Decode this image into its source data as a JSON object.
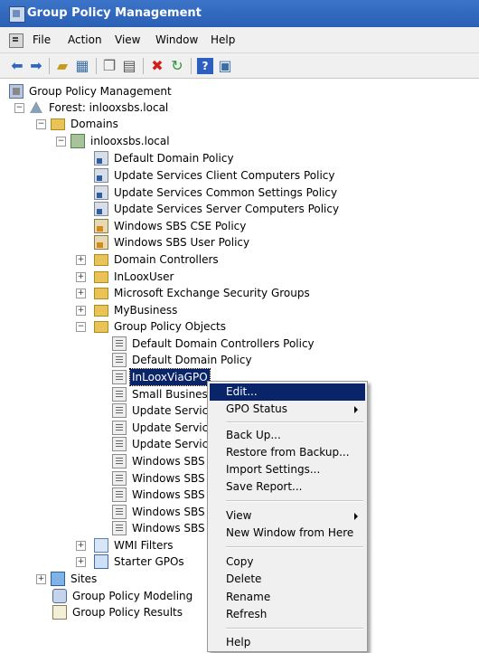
{
  "window": {
    "title": "Group Policy Management"
  },
  "menu": [
    "File",
    "Action",
    "View",
    "Window",
    "Help"
  ],
  "toolbar": {
    "icons": [
      "back-arrow-icon",
      "forward-arrow-icon",
      "up-folder-icon",
      "show-hide-tree-icon",
      "copy-icon",
      "paste-icon",
      "delete-icon",
      "refresh-icon",
      "help-icon",
      "properties-icon"
    ]
  },
  "tree": {
    "root": "Group Policy Management",
    "forest": "Forest: inlooxsbs.local",
    "domains": "Domains",
    "domain": "inlooxsbs.local",
    "linked": [
      "Default Domain Policy",
      "Update Services Client Computers Policy",
      "Update Services Common Settings Policy",
      "Update Services Server Computers Policy",
      "Windows SBS CSE Policy",
      "Windows SBS User Policy"
    ],
    "ous": [
      "Domain Controllers",
      "InLooxUser",
      "Microsoft Exchange Security Groups",
      "MyBusiness"
    ],
    "gpo_folder": "Group Policy Objects",
    "gpos": [
      "Default Domain Controllers Policy",
      "Default Domain Policy",
      "InLooxViaGPO",
      "Small Business",
      "Update Servic",
      "Update Servic",
      "Update Servic",
      "Windows SBS",
      "Windows SBS",
      "Windows SBS",
      "Windows SBS",
      "Windows SBS"
    ],
    "wmi": "WMI Filters",
    "starter": "Starter GPOs",
    "sites": "Sites",
    "modeling": "Group Policy Modeling",
    "results": "Group Policy Results"
  },
  "context_menu": {
    "edit": "Edit...",
    "gpo_status": "GPO Status",
    "back_up": "Back Up...",
    "restore": "Restore from Backup...",
    "import": "Import Settings...",
    "save_report": "Save Report...",
    "view": "View",
    "new_window": "New Window from Here",
    "copy": "Copy",
    "delete": "Delete",
    "rename": "Rename",
    "refresh": "Refresh",
    "help": "Help"
  }
}
